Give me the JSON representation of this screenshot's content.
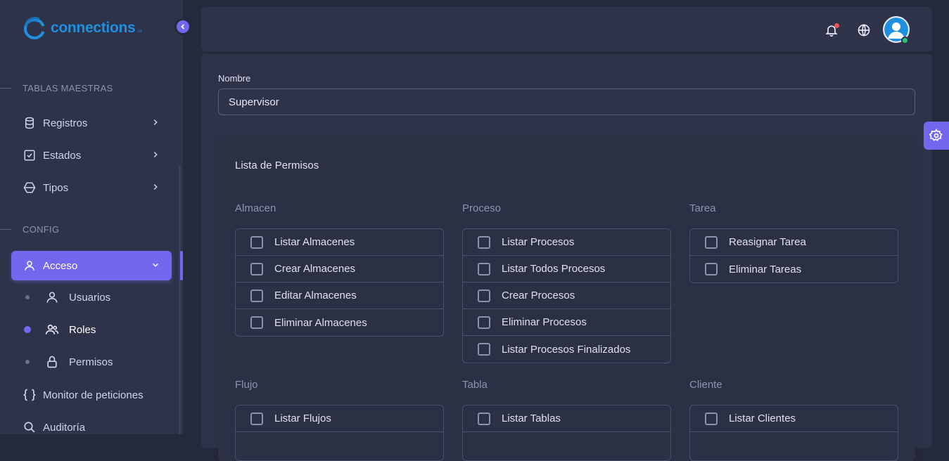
{
  "brand": {
    "name": "connections",
    "suffix": "co"
  },
  "sidebar": {
    "sections": [
      {
        "label": "TABLAS MAESTRAS"
      },
      {
        "label": "CONFIG"
      }
    ],
    "items": [
      {
        "label": "Registros",
        "icon": "database-icon"
      },
      {
        "label": "Estados",
        "icon": "checkbox-icon"
      },
      {
        "label": "Tipos",
        "icon": "hexagon-icon"
      },
      {
        "label": "Acceso",
        "icon": "user-icon",
        "active": true
      },
      {
        "label": "Monitor de peticiones",
        "icon": "braces-icon"
      },
      {
        "label": "Auditoría",
        "icon": "search-icon"
      }
    ],
    "subitems": [
      {
        "label": "Usuarios",
        "icon": "user-icon"
      },
      {
        "label": "Roles",
        "icon": "users-icon",
        "active": true
      },
      {
        "label": "Permisos",
        "icon": "lock-icon"
      }
    ]
  },
  "topbar": {
    "icons": [
      "bell-icon",
      "globe-icon",
      "avatar"
    ],
    "status_color": "#28c76f"
  },
  "form": {
    "name_label": "Nombre",
    "name_value": "Supervisor"
  },
  "permissions": {
    "title": "Lista de Permisos",
    "groups": [
      {
        "title": "Almacen",
        "items": [
          "Listar Almacenes",
          "Crear Almacenes",
          "Editar Almacenes",
          "Eliminar Almacenes"
        ]
      },
      {
        "title": "Proceso",
        "items": [
          "Listar Procesos",
          "Listar Todos Procesos",
          "Crear Procesos",
          "Eliminar Procesos",
          "Listar Procesos Finalizados"
        ]
      },
      {
        "title": "Tarea",
        "items": [
          "Reasignar Tarea",
          "Eliminar Tareas"
        ]
      },
      {
        "title": "Flujo",
        "items": [
          "Listar Flujos"
        ]
      },
      {
        "title": "Tabla",
        "items": [
          "Listar Tablas"
        ]
      },
      {
        "title": "Cliente",
        "items": [
          "Listar Clientes"
        ]
      }
    ]
  },
  "colors": {
    "accent": "#7367f0",
    "background": "#25293c",
    "surface": "#2f3349",
    "brand": "#1f8fe0"
  }
}
